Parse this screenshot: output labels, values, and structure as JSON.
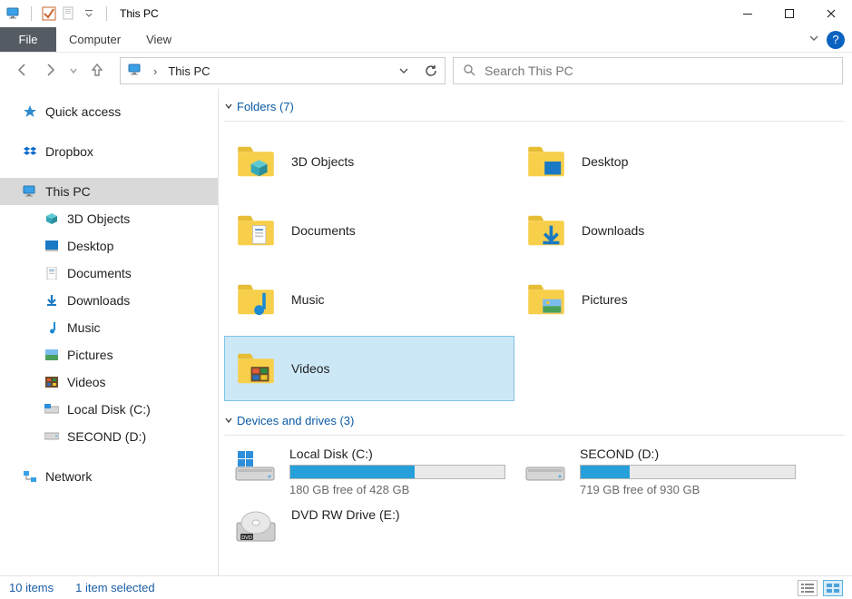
{
  "window": {
    "title": "This PC"
  },
  "ribbon": {
    "file": "File",
    "tabs": [
      "Computer",
      "View"
    ]
  },
  "address": {
    "crumb": "This PC"
  },
  "search": {
    "placeholder": "Search This PC"
  },
  "sidebar": {
    "quick_access": "Quick access",
    "dropbox": "Dropbox",
    "this_pc": "This PC",
    "children": [
      {
        "label": "3D Objects"
      },
      {
        "label": "Desktop"
      },
      {
        "label": "Documents"
      },
      {
        "label": "Downloads"
      },
      {
        "label": "Music"
      },
      {
        "label": "Pictures"
      },
      {
        "label": "Videos"
      },
      {
        "label": "Local Disk (C:)"
      },
      {
        "label": "SECOND (D:)"
      }
    ],
    "network": "Network"
  },
  "groups": {
    "folders": {
      "title": "Folders (7)"
    },
    "drives": {
      "title": "Devices and drives (3)"
    }
  },
  "folders": [
    {
      "label": "3D Objects"
    },
    {
      "label": "Desktop"
    },
    {
      "label": "Documents"
    },
    {
      "label": "Downloads"
    },
    {
      "label": "Music"
    },
    {
      "label": "Pictures"
    },
    {
      "label": "Videos",
      "selected": true
    }
  ],
  "drives": [
    {
      "label": "Local Disk (C:)",
      "free_text": "180 GB free of 428 GB",
      "used_pct": 58
    },
    {
      "label": "SECOND (D:)",
      "free_text": "719 GB free of 930 GB",
      "used_pct": 23
    },
    {
      "label": "DVD RW Drive (E:)"
    }
  ],
  "status": {
    "items": "10 items",
    "selected": "1 item selected"
  }
}
